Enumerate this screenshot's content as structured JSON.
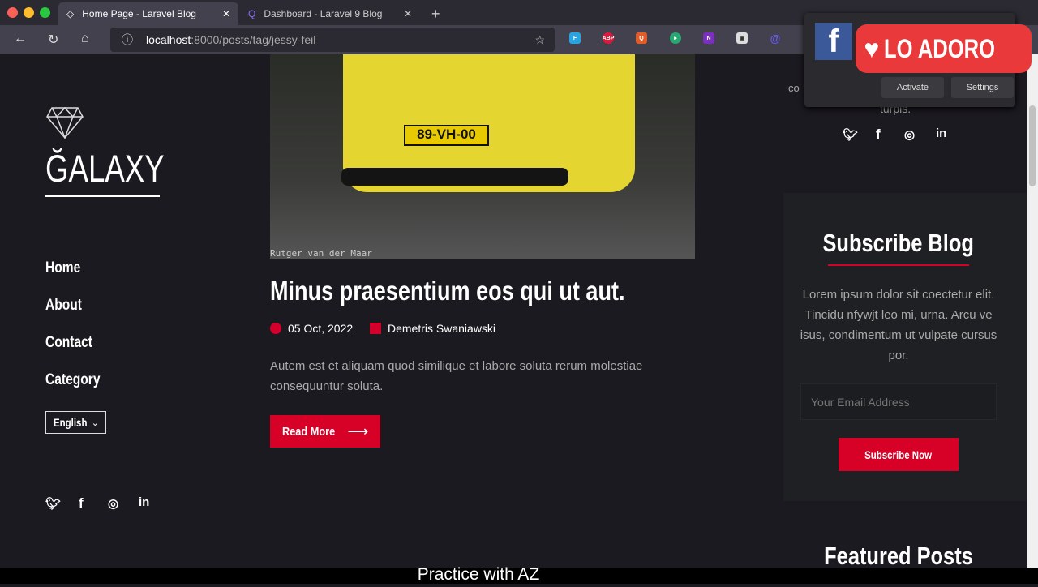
{
  "browser": {
    "tabs": [
      {
        "title": "Home Page - Laravel Blog",
        "active": true
      },
      {
        "title": "Dashboard - Laravel 9 Blog",
        "active": false
      }
    ],
    "url_host": "localhost",
    "url_path": ":8000/posts/tag/jessy-feil",
    "extensions": [
      {
        "label": "F",
        "color": "#2aa4e0"
      },
      {
        "label": "ABP",
        "color": "#e0173b"
      },
      {
        "label": "Q",
        "color": "#e05d2a"
      },
      {
        "label": "▸",
        "color": "#27a870"
      },
      {
        "label": "N",
        "color": "#7b2fbf"
      },
      {
        "label": "▣",
        "color": "#ddd"
      },
      {
        "label": "@",
        "color": "#6a5cf0"
      }
    ]
  },
  "popup": {
    "love_label": "LO ADORO",
    "activate": "Activate",
    "settings": "Settings",
    "fb_letter": "f"
  },
  "sidebar": {
    "logo": "ĞALAXY",
    "nav": [
      "Home",
      "About",
      "Contact",
      "Category"
    ],
    "language": "English",
    "social": [
      "twitter",
      "facebook",
      "instagram",
      "linkedin"
    ]
  },
  "post": {
    "image_credit": "Rutger van der Maar",
    "plate": "89-VH-00",
    "title": "Minus praesentium eos qui ut aut.",
    "date": "05 Oct, 2022",
    "author": "Demetris Swaniawski",
    "excerpt": "Autem est et aliquam quod similique et labore soluta rerum molestiae consequuntur soluta.",
    "read_more": "Read More"
  },
  "right": {
    "partial_text_1": "co",
    "partial_text_2": "turpis.",
    "subscribe_title": "Subscribe Blog",
    "subscribe_text": "Lorem ipsum dolor sit coectetur elit. Tincidu nfywjt leo mi, urna. Arcu ve isus, condimentum ut vulpate cursus por.",
    "email_placeholder": "Your Email Address",
    "subscribe_button": "Subscribe Now",
    "featured_title": "Featured Posts"
  },
  "caption": "Practice with AZ",
  "colors": {
    "accent": "#d70026",
    "background": "#1b1a20"
  }
}
